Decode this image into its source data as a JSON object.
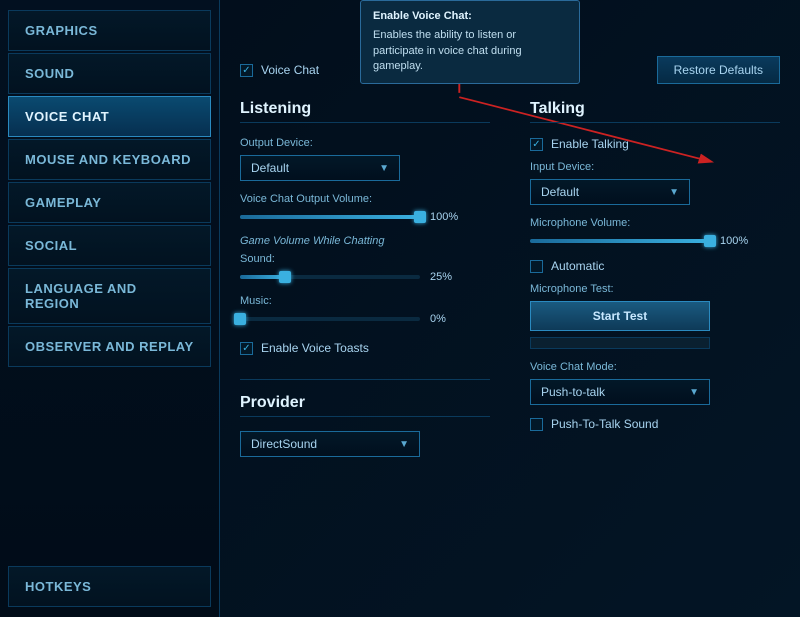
{
  "sidebar": {
    "items": [
      {
        "id": "graphics",
        "label": "Graphics",
        "active": false
      },
      {
        "id": "sound",
        "label": "Sound",
        "active": false
      },
      {
        "id": "voice-chat",
        "label": "Voice Chat",
        "active": true
      },
      {
        "id": "mouse-keyboard",
        "label": "Mouse and Keyboard",
        "active": false
      },
      {
        "id": "gameplay",
        "label": "Gameplay",
        "active": false
      },
      {
        "id": "social",
        "label": "Social",
        "active": false
      },
      {
        "id": "language-region",
        "label": "Language and Region",
        "active": false
      },
      {
        "id": "observer-replay",
        "label": "Observer and Replay",
        "active": false
      }
    ],
    "bottom_items": [
      {
        "id": "hotkeys",
        "label": "Hotkeys",
        "active": false
      }
    ]
  },
  "tooltip": {
    "title": "Enable Voice Chat:",
    "body": "Enables the ability to listen or participate in voice chat during gameplay."
  },
  "top": {
    "voice_chat_label": "Voice Chat",
    "restore_btn": "Restore Defaults"
  },
  "listening": {
    "title": "Listening",
    "output_device_label": "Output Device:",
    "output_device_value": "Default",
    "volume_label": "Voice Chat Output Volume:",
    "volume_value": "100%",
    "volume_pct": 100,
    "game_volume_title": "Game Volume While Chatting",
    "sound_label": "Sound:",
    "sound_value": "25%",
    "sound_pct": 25,
    "music_label": "Music:",
    "music_value": "0%",
    "music_pct": 0,
    "enable_toasts_label": "Enable Voice Toasts"
  },
  "talking": {
    "title": "Talking",
    "enable_talking_label": "Enable Talking",
    "input_device_label": "Input Device:",
    "input_device_value": "Default",
    "mic_volume_label": "Microphone Volume:",
    "mic_volume_value": "100%",
    "mic_volume_pct": 100,
    "automatic_label": "Automatic",
    "mic_test_label": "Microphone Test:",
    "start_test_btn": "Start Test",
    "voice_chat_mode_label": "Voice Chat Mode:",
    "voice_chat_mode_value": "Push-to-talk",
    "push_to_talk_sound_label": "Push-To-Talk Sound"
  },
  "provider": {
    "title": "Provider",
    "value": "DirectSound"
  }
}
